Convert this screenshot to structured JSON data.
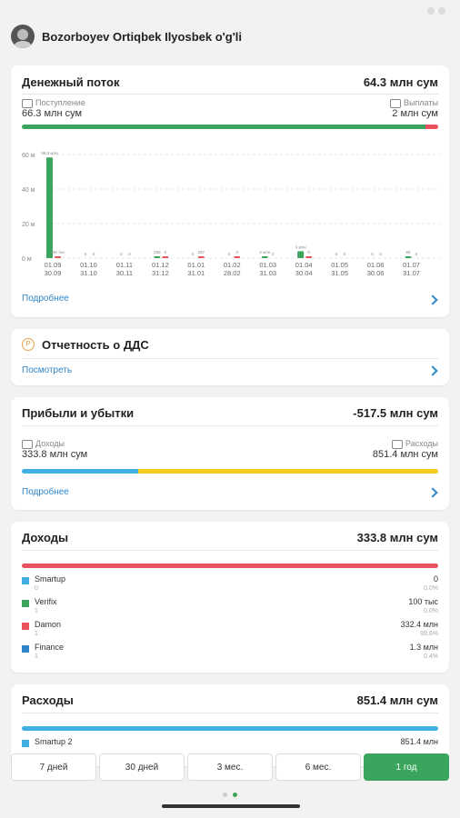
{
  "user": {
    "name": "Bozorboyev Ortiqbek Ilyosbek o'g'li"
  },
  "cash_flow": {
    "title": "Денежный поток",
    "total": "64.3 млн сум",
    "income_label": "Поступление",
    "income_value": "66.3 млн сум",
    "expense_label": "Выплаты",
    "expense_value": "2 млн сум",
    "more": "Подробнее",
    "colors": {
      "income": "#3ba55d",
      "expense": "#e8525e"
    },
    "bar_income_fraction": 0.97
  },
  "chart_data": {
    "type": "bar",
    "y_ticks": [
      "60 м",
      "40 м",
      "20 м",
      "0 м"
    ],
    "ylim": [
      0,
      60
    ],
    "categories": [
      "01.09\n30.09",
      "01.10\n31.10",
      "01.11\n30.11",
      "01.12\n31.12",
      "01.01\n31.01",
      "01.02\n28.02",
      "01.03\n31.03",
      "01.04\n30.04",
      "01.05\n31.05",
      "01.06\n30.06",
      "01.07\n31.07"
    ],
    "series": [
      {
        "name": "Поступление",
        "values": [
          58.3,
          0,
          0,
          0.3,
          0,
          0,
          0.8,
          4.0,
          0,
          0,
          0.1
        ]
      },
      {
        "name": "Выплаты",
        "values": [
          0.3,
          0,
          0,
          0.2,
          0.3,
          0.1,
          0,
          0.1,
          0,
          0,
          0
        ]
      }
    ],
    "bar_labels": [
      [
        "58.3 млн",
        "136 тыс"
      ],
      [
        "0",
        "0"
      ],
      [
        "0",
        "0"
      ],
      [
        "255",
        "0"
      ],
      [
        "0",
        "287"
      ],
      [
        "0",
        "0"
      ],
      [
        "2 млн",
        "0"
      ],
      [
        "4 млн",
        "0"
      ],
      [
        "0",
        "0"
      ],
      [
        "0",
        "0"
      ],
      [
        "65",
        "0"
      ]
    ],
    "grid": true
  },
  "dds": {
    "title": "Отчетность о ДДС",
    "link": "Посмотреть"
  },
  "pnl": {
    "title": "Прибыли и убытки",
    "total": "-517.5 млн сум",
    "income_label": "Доходы",
    "income_value": "333.8 млн сум",
    "expense_label": "Расходы",
    "expense_value": "851.4 млн сум",
    "more": "Подробнее",
    "colors": {
      "income": "#41afe3",
      "expense": "#f2cb1f"
    },
    "bar_income_fraction": 0.28
  },
  "income": {
    "title": "Доходы",
    "total": "333.8 млн сум",
    "bar_color": "#e8525e",
    "items": [
      {
        "name": "Smartup",
        "sub": "0",
        "value": "0",
        "pct": "0.0%",
        "color": "#41afe3"
      },
      {
        "name": "Verifix",
        "sub": "1",
        "value": "100 тыс",
        "pct": "0.0%",
        "color": "#3ba55d"
      },
      {
        "name": "Damon",
        "sub": "1",
        "value": "332.4 млн",
        "pct": "99.6%",
        "color": "#e8525e"
      },
      {
        "name": "Finance",
        "sub": "1",
        "value": "1.3 млн",
        "pct": "0.4%",
        "color": "#2f86c9"
      }
    ]
  },
  "expenses": {
    "title": "Расходы",
    "total": "851.4 млн сум",
    "bar_color": "#41afe3",
    "items": [
      {
        "name": "Smartup 2",
        "value": "851.4 млн"
      }
    ]
  },
  "periods": {
    "items": [
      "7 дней",
      "30 дней",
      "3 мес.",
      "6 мес.",
      "1 год"
    ],
    "active": "1 год"
  }
}
